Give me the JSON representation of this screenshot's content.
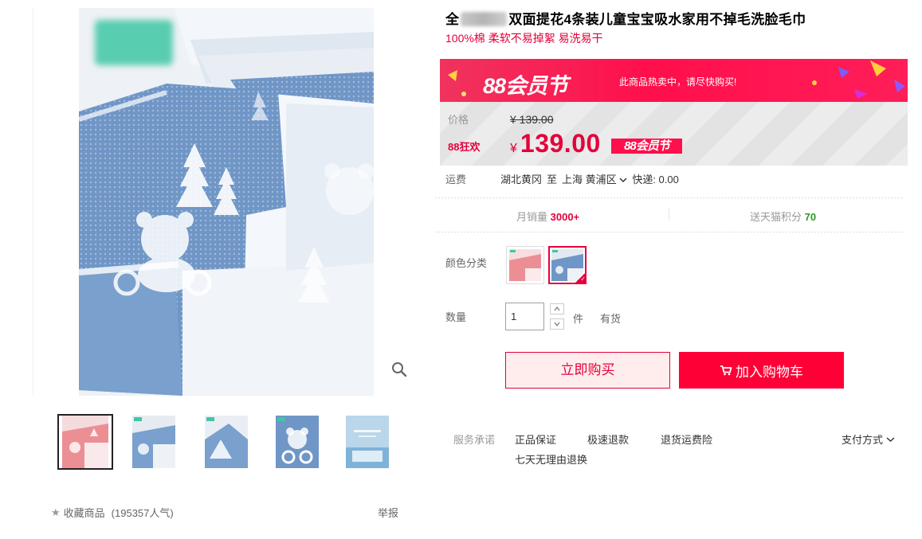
{
  "product": {
    "title_start": "全",
    "title_rest": "双面提花4条装儿童宝宝吸水家用不掉毛洗脸毛巾",
    "subtitle": "100%棉 柔软不易掉絮 易洗易干"
  },
  "promo": {
    "logo": "88会员节",
    "hot_text": "此商品热卖中，请尽快购买!",
    "price_label": "价格",
    "original_price": "¥ 139.00",
    "promo_label": "88狂欢",
    "currency": "¥",
    "promo_price": "139.00",
    "badge": "88会员节"
  },
  "shipping": {
    "label": "运费",
    "from": "湖北黄冈",
    "to_word": "至",
    "to_city": "上海",
    "to_district": "黄浦区",
    "fee": "快递: 0.00"
  },
  "stats": {
    "monthly_sales_label": "月销量",
    "monthly_sales_value": "3000+",
    "points_label": "送天猫积分",
    "points_value": "70"
  },
  "sku": {
    "label": "颜色分类",
    "options": [
      "pink",
      "blue"
    ],
    "selected": "blue"
  },
  "quantity": {
    "label": "数量",
    "value": "1",
    "unit": "件",
    "stock": "有货"
  },
  "actions": {
    "buy_now": "立即购买",
    "add_to_cart": "加入购物车"
  },
  "services": {
    "label": "服务承诺",
    "items": [
      "正品保证",
      "极速退款",
      "退货运费险",
      "七天无理由退换"
    ],
    "payment": "支付方式"
  },
  "gallery": {
    "collect_label": "收藏商品",
    "collect_count": "(195357人气)",
    "report": "举报"
  },
  "colors": {
    "accent": "#e4003a",
    "cart_button": "#ff0036",
    "towel_blue": "#6f96c6"
  }
}
